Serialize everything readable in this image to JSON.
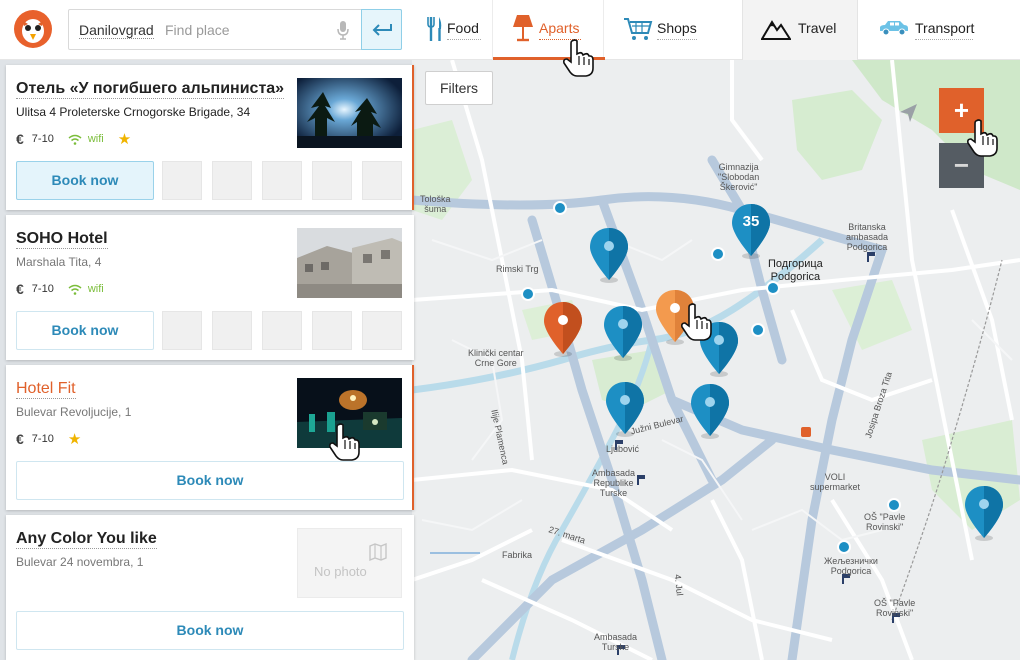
{
  "header": {
    "city": "Danilovgrad",
    "search_placeholder": "Find place",
    "tabs": [
      {
        "label": "Food"
      },
      {
        "label": "Aparts"
      },
      {
        "label": "Shops"
      },
      {
        "label": "Travel"
      },
      {
        "label": "Transport"
      }
    ],
    "accent_color": "#e0612b",
    "active_tab": "Aparts"
  },
  "listings": [
    {
      "name": "Отель «У погибшего альпиниста»",
      "address": "Ulitsa 4 Proleterske Crnogorske Brigade, 34",
      "price": "7-10",
      "wifi": "wifi",
      "star": "★",
      "book": "Book now"
    },
    {
      "name": "SOHO Hotel",
      "address": "Marshala Tita, 4",
      "price": "7-10",
      "wifi": "wifi",
      "book": "Book now"
    },
    {
      "name": "Hotel Fit",
      "address": "Bulevar Revoljucije, 1",
      "price": "7-10",
      "star": "★",
      "book": "Book now"
    },
    {
      "name": "Any Color You like",
      "address": "Bulevar 24 novembra, 1",
      "no_photo": "No photo",
      "book": "Book now"
    }
  ],
  "currency_symbol": "€",
  "map": {
    "filters": "Filters",
    "zoom_in": "+",
    "zoom_out": "−",
    "cluster_count": "35",
    "labels": {
      "tloska": "Tološka\nšuma",
      "gimnazija": "Gimnazija\n\"Slobodan\nŠkerović\"",
      "britanska": "Britanska\nambasada\nPodgorica",
      "podgorica": "Подгорица\nPodgorica",
      "rimski": "Rimski Trg",
      "klinicki": "Klinički centar\nCrne Gore",
      "ljubovic": "Ljubović",
      "ambasada": "Ambasada\nRepublike\nTurske",
      "juzni": "Južni Bulevar",
      "josipa": "Josipa Broza Tita",
      "ilije": "Ilije Plamenca",
      "voli": "VOLI\nsupermarket",
      "os_pavle": "OŠ \"Pavle\nRovinski\"",
      "os_pavle2": "OŠ \"Pavle\nRovinski\"",
      "zlj": "Жељезнички\nPodgorica",
      "fabrika": "Fabrika",
      "mart": "27. marta",
      "jul": "4. Jul",
      "ambasada_t": "Ambasada\nTurske"
    }
  }
}
